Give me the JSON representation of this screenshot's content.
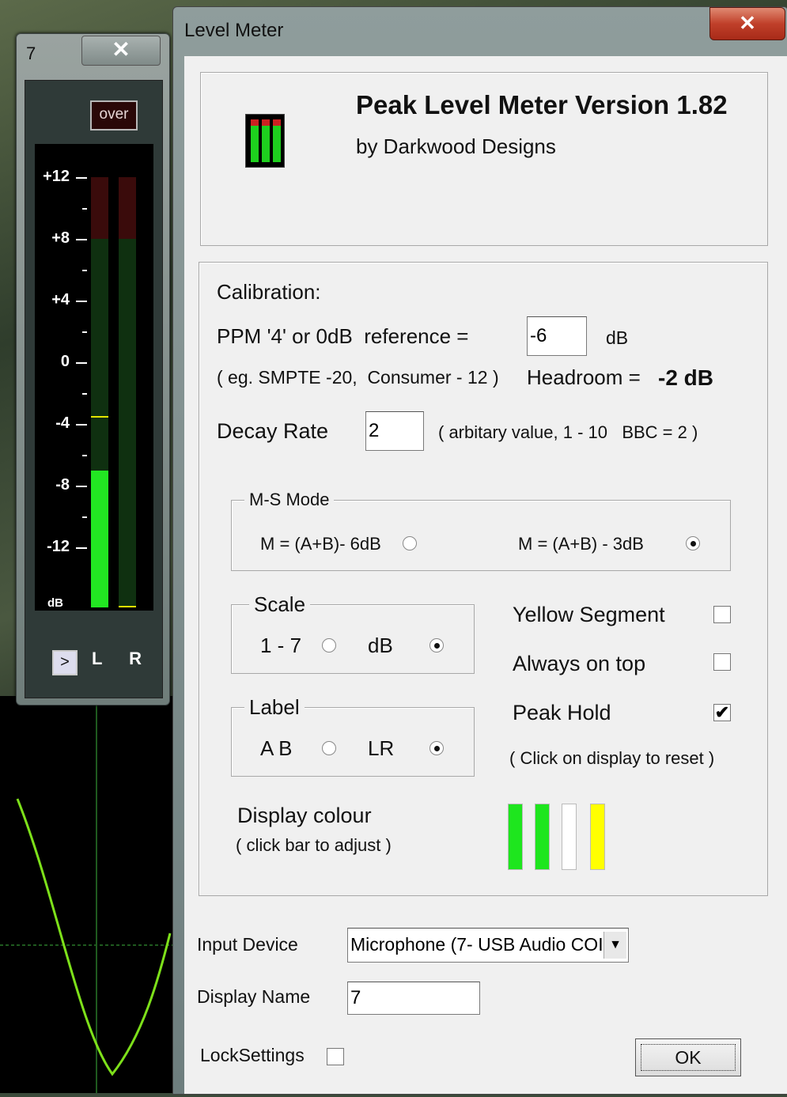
{
  "meter_window": {
    "title": "7",
    "close_label": "✕",
    "over_label": "over",
    "ticks": [
      "+12",
      "+8",
      "+4",
      "0",
      "-4",
      "-8",
      "-12"
    ],
    "unit_label": "dB",
    "expand_label": ">",
    "channels_label": "L R",
    "left_level_db": -7,
    "left_peak_db": -3.5,
    "right_level_db": -16
  },
  "dialog": {
    "title": "Level Meter",
    "close_label": "✕",
    "app_name": "Peak Level Meter Version 1.82",
    "author": "by Darkwood Designs",
    "calibration": {
      "heading": "Calibration:",
      "reference_label": "PPM '4' or 0dB  reference =",
      "reference_value": "-6",
      "reference_unit": "dB",
      "examples": "( eg. SMPTE -20,  Consumer - 12 )",
      "headroom_label": "Headroom =",
      "headroom_value": "-2 dB",
      "decay_label": "Decay Rate",
      "decay_value": "2",
      "decay_hint": "( arbitary value, 1 - 10   BBC = 2 )"
    },
    "ms_mode": {
      "legend": "M-S Mode",
      "option1": "M = (A+B)- 6dB",
      "option2": "M = (A+B) - 3dB",
      "selected": 2
    },
    "scale": {
      "legend": "Scale",
      "option1": "1 - 7",
      "option2": "dB",
      "selected": 2
    },
    "label_group": {
      "legend": "Label",
      "option1": "A B",
      "option2": "LR",
      "selected": 2
    },
    "checks": {
      "yellow_segment": "Yellow Segment",
      "yellow_segment_checked": false,
      "always_on_top": "Always on top",
      "always_on_top_checked": false,
      "peak_hold": "Peak Hold",
      "peak_hold_checked": true,
      "reset_hint": "( Click on display to reset )",
      "check_mark": "✔"
    },
    "display_colour": {
      "label": "Display colour",
      "hint": "( click bar to adjust )",
      "colors": [
        "#1ee61e",
        "#1ee61e",
        "#ffffff",
        "#ffff00"
      ]
    },
    "input_device_label": "Input Device",
    "input_device_value": "Microphone (7- USB Audio COI",
    "display_name_label": "Display Name",
    "display_name_value": "7",
    "lock_settings_label": "LockSettings",
    "lock_settings_checked": false,
    "ok_label": "OK"
  }
}
